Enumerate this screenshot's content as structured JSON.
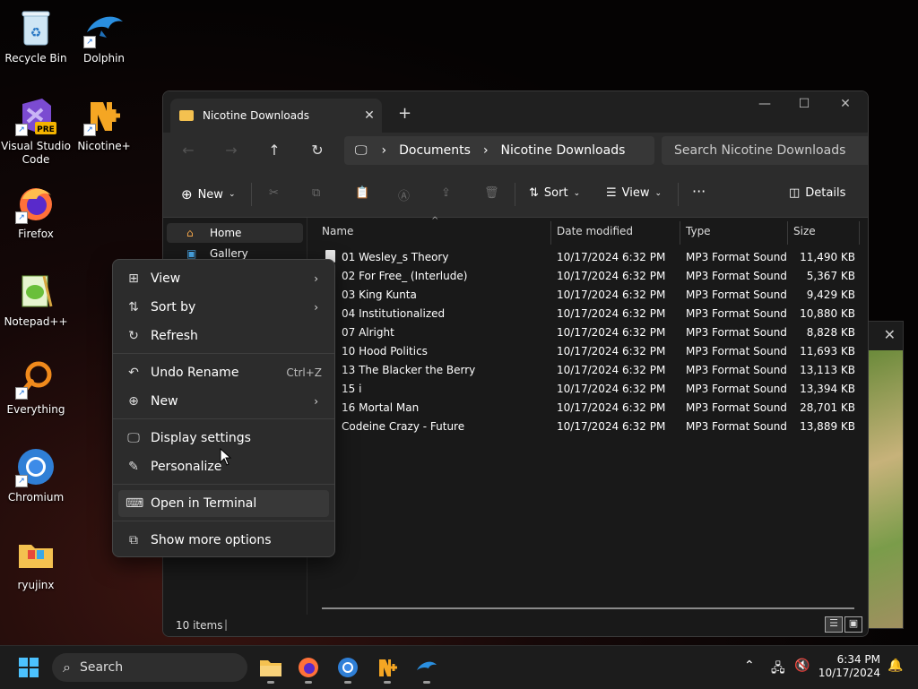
{
  "desktop": {
    "icons": [
      {
        "label": "Recycle Bin"
      },
      {
        "label": "Dolphin"
      },
      {
        "label": "Visual Studio Code"
      },
      {
        "label": "Nicotine+"
      },
      {
        "label": "Firefox"
      },
      {
        "label": "Notepad++"
      },
      {
        "label": "Everything"
      },
      {
        "label": "Chromium"
      },
      {
        "label": "ryujinx"
      }
    ]
  },
  "explorer": {
    "tab_title": "Nicotine Downloads",
    "breadcrumb": [
      "Documents",
      "Nicotine Downloads"
    ],
    "search_placeholder": "Search Nicotine Downloads",
    "toolbar": {
      "new": "New",
      "sort": "Sort",
      "view": "View",
      "more": "···",
      "details": "Details"
    },
    "nav": [
      {
        "label": "Home"
      },
      {
        "label": "Gallery"
      }
    ],
    "columns": {
      "name": "Name",
      "date": "Date modified",
      "type": "Type",
      "size": "Size"
    },
    "files": [
      {
        "name": "01 Wesley_s Theory",
        "date": "10/17/2024 6:32 PM",
        "type": "MP3 Format Sound",
        "size": "11,490 KB"
      },
      {
        "name": "02 For Free_ (Interlude)",
        "date": "10/17/2024 6:32 PM",
        "type": "MP3 Format Sound",
        "size": "5,367 KB"
      },
      {
        "name": "03 King Kunta",
        "date": "10/17/2024 6:32 PM",
        "type": "MP3 Format Sound",
        "size": "9,429 KB"
      },
      {
        "name": "04 Institutionalized",
        "date": "10/17/2024 6:32 PM",
        "type": "MP3 Format Sound",
        "size": "10,880 KB"
      },
      {
        "name": "07 Alright",
        "date": "10/17/2024 6:32 PM",
        "type": "MP3 Format Sound",
        "size": "8,828 KB"
      },
      {
        "name": "10 Hood Politics",
        "date": "10/17/2024 6:32 PM",
        "type": "MP3 Format Sound",
        "size": "11,693 KB"
      },
      {
        "name": "13 The Blacker the Berry",
        "date": "10/17/2024 6:32 PM",
        "type": "MP3 Format Sound",
        "size": "13,113 KB"
      },
      {
        "name": "15 i",
        "date": "10/17/2024 6:32 PM",
        "type": "MP3 Format Sound",
        "size": "13,394 KB"
      },
      {
        "name": "16 Mortal Man",
        "date": "10/17/2024 6:32 PM",
        "type": "MP3 Format Sound",
        "size": "28,701 KB"
      },
      {
        "name": "Codeine Crazy - Future",
        "date": "10/17/2024 6:32 PM",
        "type": "MP3 Format Sound",
        "size": "13,889 KB"
      }
    ],
    "status": "10 items"
  },
  "context_menu": {
    "view": "View",
    "sort_by": "Sort by",
    "refresh": "Refresh",
    "undo_rename": "Undo Rename",
    "undo_shortcut": "Ctrl+Z",
    "new": "New",
    "display_settings": "Display settings",
    "personalize": "Personalize",
    "open_terminal": "Open in Terminal",
    "show_more": "Show more options"
  },
  "taskbar": {
    "search_label": "Search",
    "time": "6:34 PM",
    "date": "10/17/2024"
  },
  "colors": {
    "accent": "#0078d4",
    "folder": "#f4c150",
    "menu_bg": "#2c2c2c"
  }
}
